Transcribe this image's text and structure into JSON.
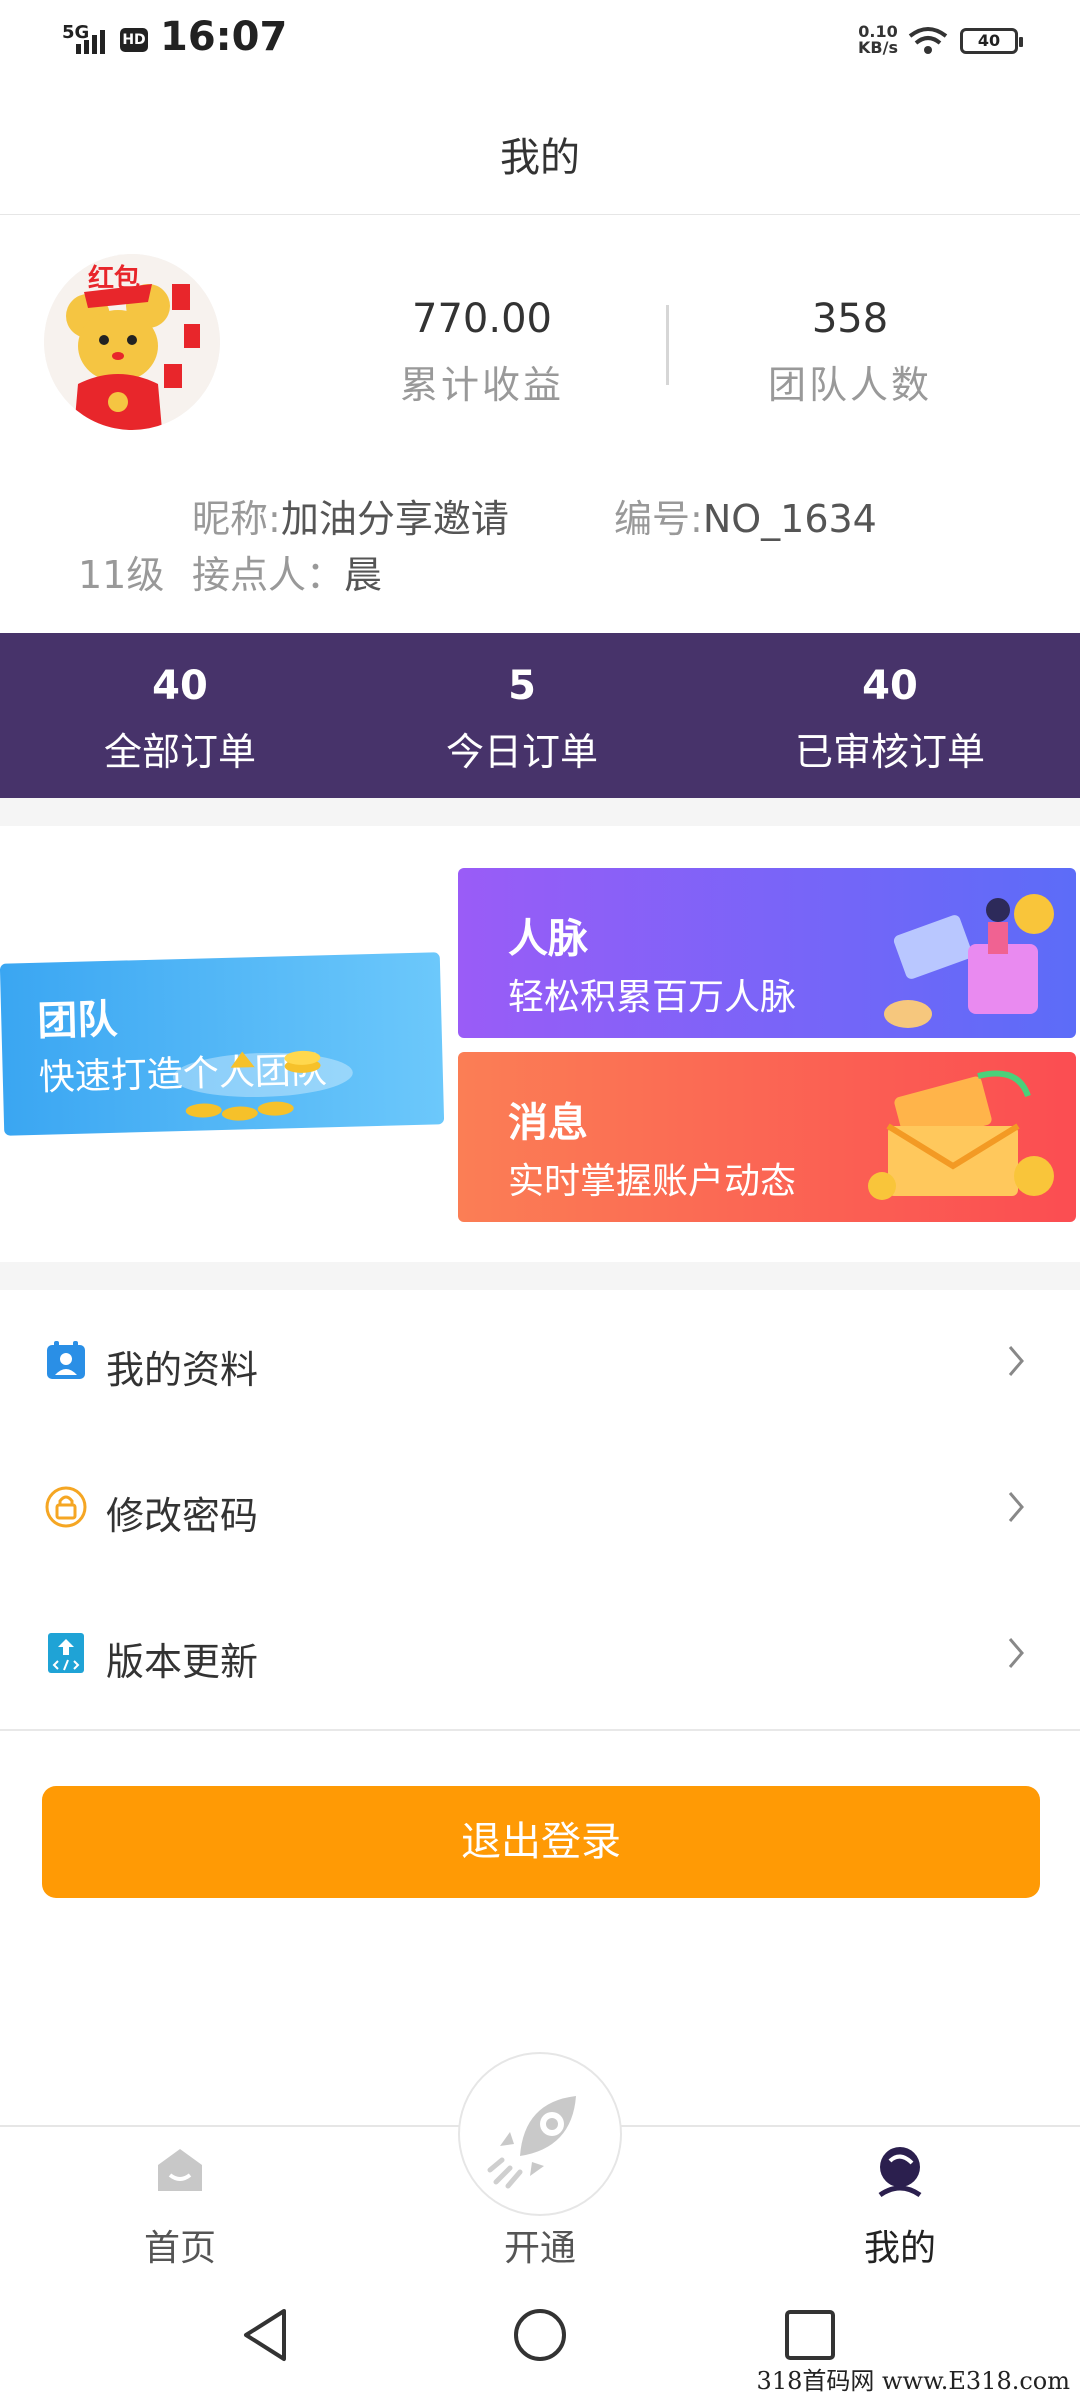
{
  "status_bar": {
    "network": "5G",
    "hd": "HD",
    "time": "16:07",
    "speed_value": "0.10",
    "speed_unit": "KB/s",
    "battery": "40"
  },
  "header": {
    "title": "我的"
  },
  "profile": {
    "avatar_text": "红包",
    "earnings_value": "770.00",
    "earnings_label": "累计收益",
    "team_value": "358",
    "team_label": "团队人数",
    "nickname_label": "昵称:",
    "nickname": "加油分享邀请",
    "id_label": "编号:",
    "id": "NO_1634",
    "level": "11级",
    "referrer_label": "接点人：",
    "referrer": "晨"
  },
  "orders": [
    {
      "value": "40",
      "label": "全部订单"
    },
    {
      "value": "5",
      "label": "今日订单"
    },
    {
      "value": "40",
      "label": "已审核订单"
    }
  ],
  "cards": {
    "team": {
      "title": "团队",
      "subtitle": "快速打造个人团队"
    },
    "contacts": {
      "title": "人脉",
      "subtitle": "轻松积累百万人脉"
    },
    "messages": {
      "title": "消息",
      "subtitle": "实时掌握账户动态"
    }
  },
  "menu": [
    {
      "label": "我的资料",
      "icon": "profile-card-icon"
    },
    {
      "label": "修改密码",
      "icon": "lock-icon"
    },
    {
      "label": "版本更新",
      "icon": "update-icon"
    }
  ],
  "logout_label": "退出登录",
  "bottom_nav": [
    {
      "label": "首页",
      "icon": "home-icon"
    },
    {
      "label": "开通",
      "icon": "rocket-icon"
    },
    {
      "label": "我的",
      "icon": "user-icon"
    }
  ],
  "watermark": "318首码网  www.E318.com",
  "colors": {
    "accent_purple": "#47336a",
    "logout_orange": "#ff9a05",
    "card_blue": "#3aa6f2",
    "card_violet": "#8a5cf6",
    "card_red": "#fb5a4e"
  }
}
